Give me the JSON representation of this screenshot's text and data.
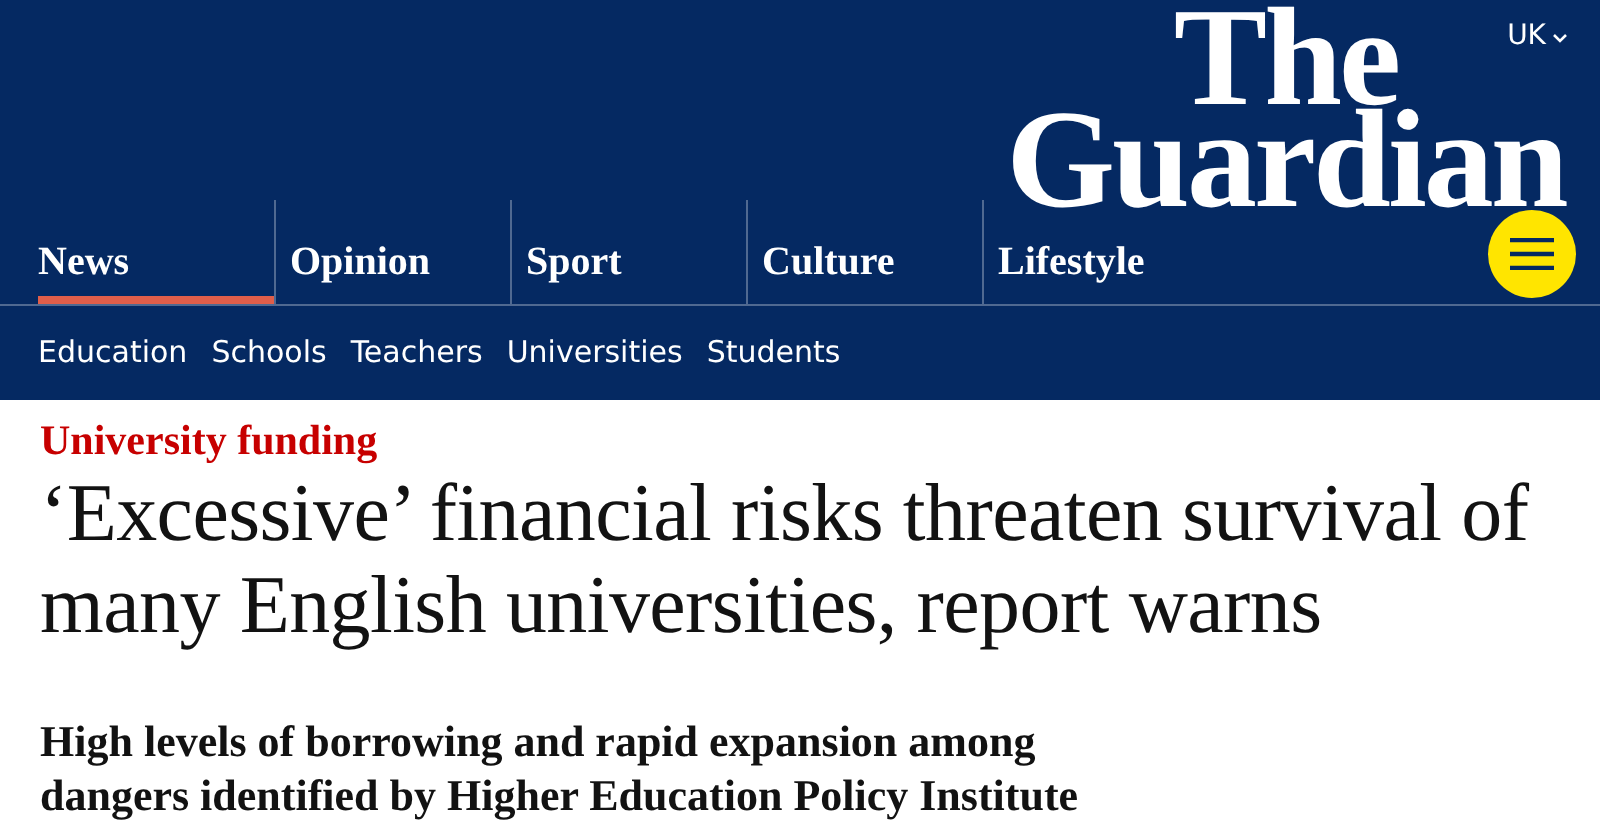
{
  "header": {
    "edition": "UK",
    "logo": [
      "The",
      "Guardian"
    ]
  },
  "pillars": [
    {
      "label": "News",
      "selected": true
    },
    {
      "label": "Opinion",
      "selected": false
    },
    {
      "label": "Sport",
      "selected": false
    },
    {
      "label": "Culture",
      "selected": false
    },
    {
      "label": "Lifestyle",
      "selected": false
    }
  ],
  "subnav": [
    "Education",
    "Schools",
    "Teachers",
    "Universities",
    "Students"
  ],
  "article": {
    "kicker": "University funding",
    "headline": "‘Excessive’ financial risks threaten survival of many English universities, report warns",
    "standfirst": "High levels of borrowing and rapid expansion among dangers identified by Higher Education Policy Institute"
  }
}
